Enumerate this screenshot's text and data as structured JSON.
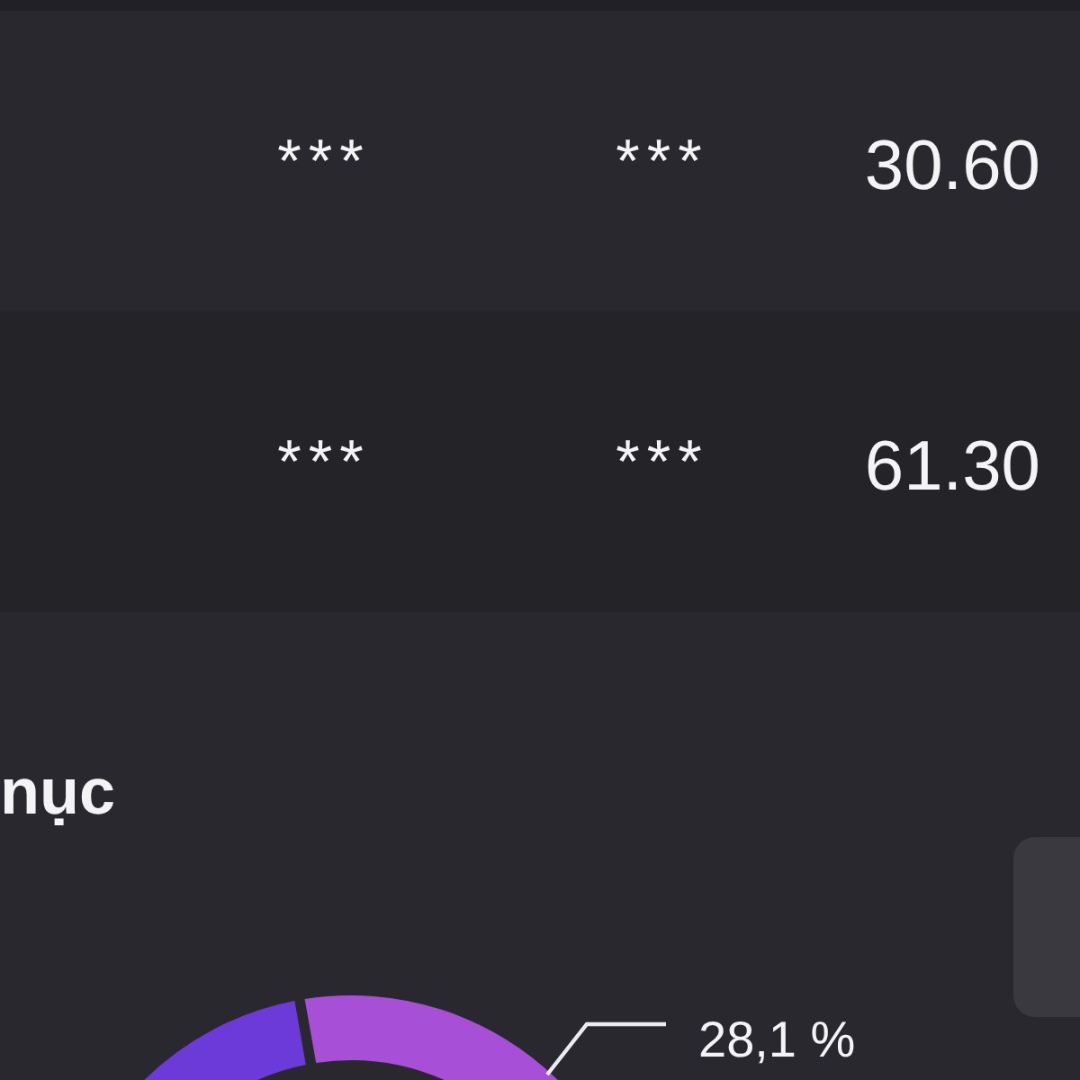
{
  "table": {
    "rows": [
      {
        "cells": [
          "***",
          "***",
          "30.60"
        ]
      },
      {
        "cells": [
          "***",
          "***",
          "61.30"
        ]
      }
    ]
  },
  "section": {
    "title": "nục"
  },
  "chart": {
    "segments": [
      {
        "color": "#6b3ad8"
      },
      {
        "color": "#a84fd8"
      }
    ],
    "callouts": [
      {
        "text": "28,1 %"
      }
    ]
  }
}
